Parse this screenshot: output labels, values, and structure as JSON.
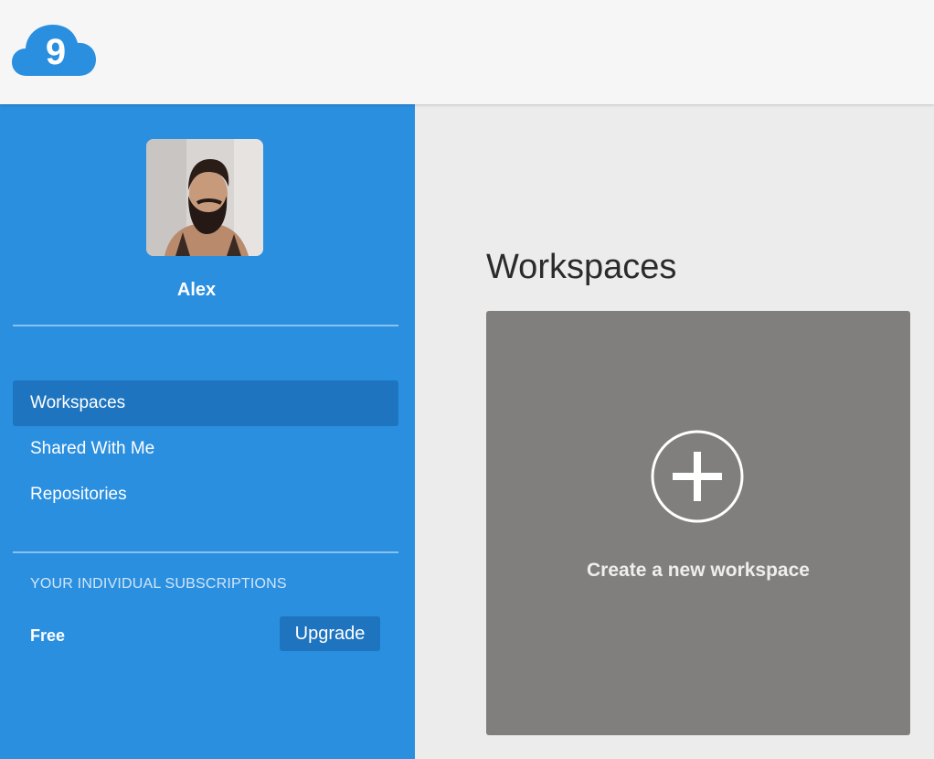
{
  "app": {
    "logo_icon": "cloud9-cloud-logo-icon",
    "logo_glyph": "9",
    "brand_color": "#2b8fe0"
  },
  "sidebar": {
    "user": {
      "name": "Alex",
      "avatar_icon": "user-avatar-photo"
    },
    "nav": [
      {
        "label": "Workspaces",
        "active": true
      },
      {
        "label": "Shared With Me",
        "active": false
      },
      {
        "label": "Repositories",
        "active": false
      }
    ],
    "subscriptions": {
      "heading": "YOUR INDIVIDUAL SUBSCRIPTIONS",
      "plan": "Free",
      "upgrade_label": "Upgrade"
    },
    "colors": {
      "background": "#2b8fe0",
      "active_item": "#1e74bf"
    }
  },
  "main": {
    "title": "Workspaces",
    "create_card": {
      "label": "Create a new workspace",
      "icon": "plus-circle-icon",
      "background": "#807f7d"
    }
  }
}
